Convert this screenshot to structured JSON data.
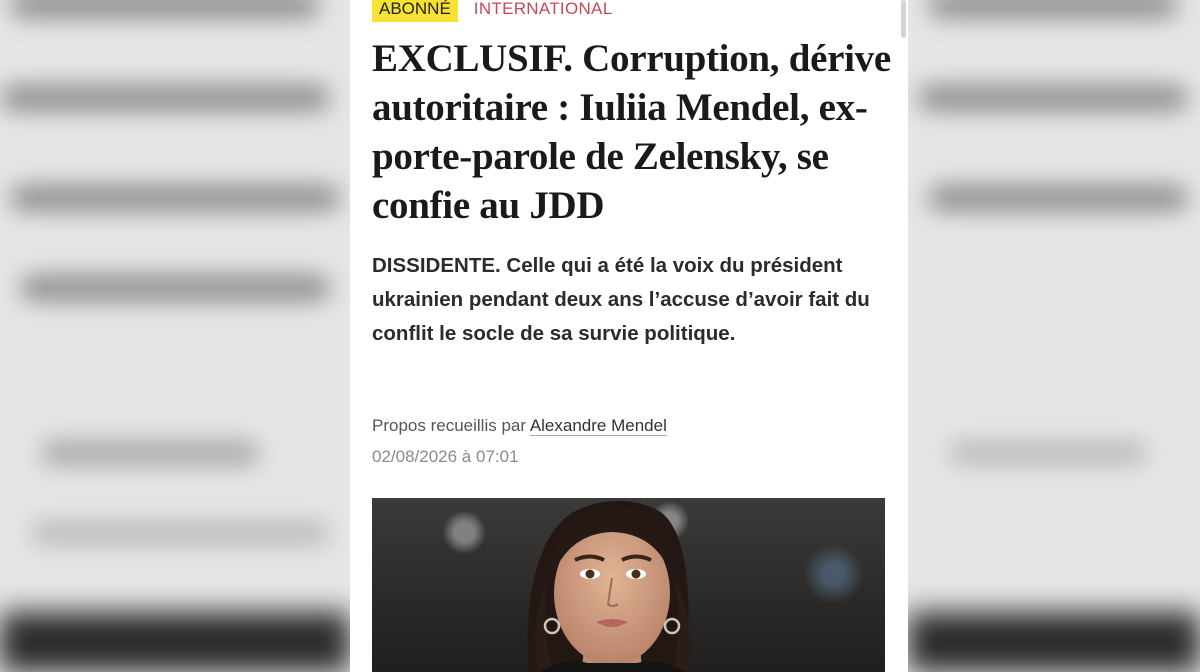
{
  "article": {
    "badge": "ABONNÉ",
    "section": "INTERNATIONAL",
    "headline": "EXCLUSIF. Corruption, dérive autoritaire : Iuliia Mendel, ex-porte-parole de Zelensky, se confie au JDD",
    "chapo": "DISSIDENTE. Celle qui a été la voix du président ukrainien pendant deux ans l’accuse d’avoir fait du conflit le socle de sa survie politique.",
    "byline_prefix": "Propos recueillis par",
    "author": "Alexandre Mendel",
    "date": "02/08/2026 à 07:01"
  },
  "colors": {
    "badge_bg": "#f7e234",
    "section": "#c8475b",
    "headline": "#1a1a1a"
  },
  "photo": {
    "subject_icon": "portrait-photo"
  }
}
